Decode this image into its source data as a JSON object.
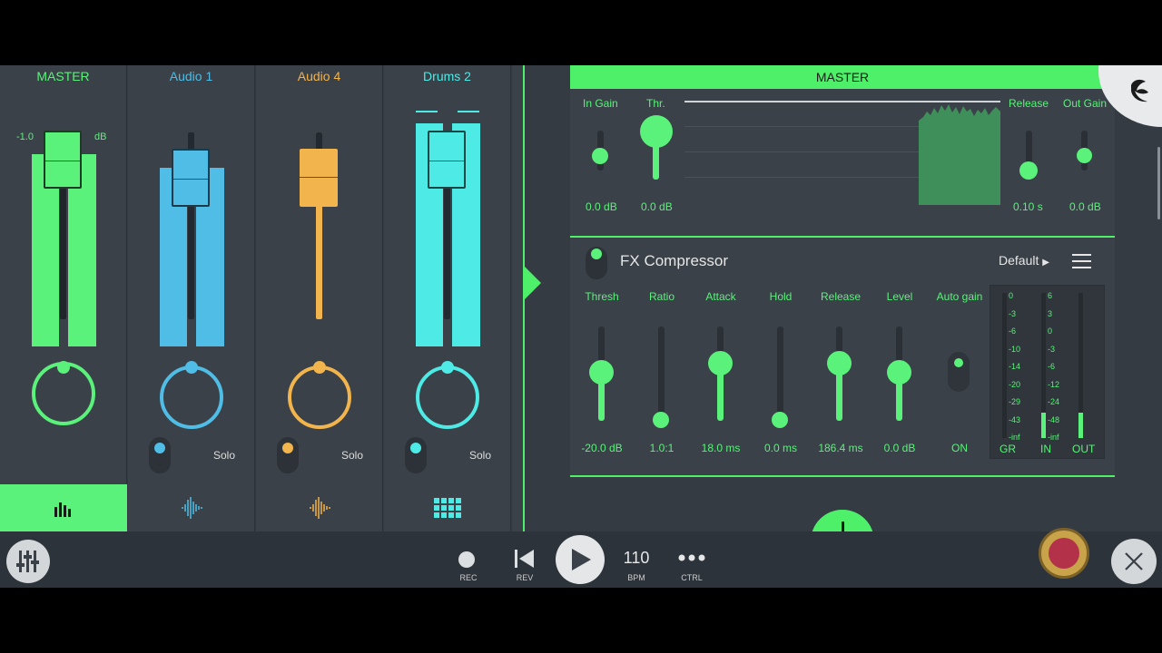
{
  "channels": [
    {
      "name": "MASTER",
      "color": "#5af27a",
      "fader_left_label": "-1.0",
      "fader_right_label": "dB",
      "footer_icon": "mixer-bars-icon"
    },
    {
      "name": "Audio 1",
      "color": "#4fbde6",
      "solo_label": "Solo",
      "footer_icon": "waveform-icon"
    },
    {
      "name": "Audio 4",
      "color": "#f2b44c",
      "solo_label": "Solo",
      "footer_icon": "waveform-icon"
    },
    {
      "name": "Drums 2",
      "color": "#4eeae6",
      "solo_label": "Solo",
      "footer_icon": "drum-grid-icon"
    }
  ],
  "plugin_header": "MASTER",
  "gain_section": {
    "in_gain_label": "In Gain",
    "in_gain_value": "0.0 dB",
    "threshold_label": "Thr.",
    "threshold_value": "0.0 dB",
    "release_label": "Release",
    "release_value": "0.10 s",
    "out_gain_label": "Out Gain",
    "out_gain_value": "0.0 dB"
  },
  "compressor": {
    "title": "FX Compressor",
    "preset": "Default",
    "params": [
      {
        "label": "Thresh",
        "value": "-20.0 dB"
      },
      {
        "label": "Ratio",
        "value": "1.0:1"
      },
      {
        "label": "Attack",
        "value": "18.0 ms"
      },
      {
        "label": "Hold",
        "value": "0.0 ms"
      },
      {
        "label": "Release",
        "value": "186.4 ms"
      },
      {
        "label": "Level",
        "value": "0.0 dB"
      },
      {
        "label": "Auto gain",
        "value": "ON"
      }
    ],
    "meter": {
      "gr_scale": [
        "0",
        "-3",
        "-6",
        "-10",
        "-14",
        "-20",
        "-29",
        "-43",
        "-inf"
      ],
      "io_scale": [
        "6",
        "3",
        "0",
        "-3",
        "-6",
        "-12",
        "-24",
        "-48",
        "-inf"
      ],
      "labels": [
        "GR",
        "IN",
        "OUT"
      ]
    }
  },
  "transport": {
    "rec_label": "REC",
    "rev_label": "REV",
    "bpm_value": "110",
    "bpm_label": "BPM",
    "ctrl_label": "CTRL"
  },
  "colors": {
    "accent": "#5af27a",
    "background": "#343b42"
  }
}
